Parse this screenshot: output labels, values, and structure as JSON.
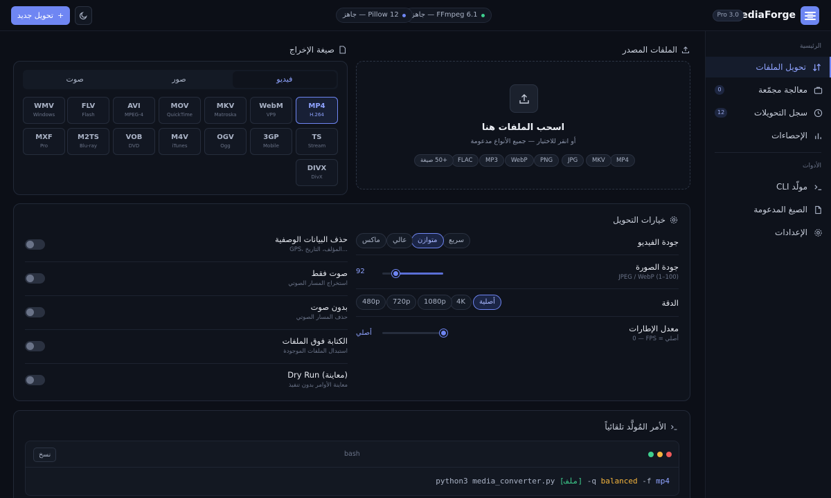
{
  "header": {
    "brand": "MediaForge",
    "badge": "Pro 3.0",
    "status": [
      {
        "label": "FFmpeg 6.1 — جاهز",
        "color": "#3ecf8e"
      },
      {
        "label": "Pillow 12 — جاهز",
        "color": "#6f86f3"
      }
    ],
    "new_button": "تحويل جديد",
    "new_button_icon": "+"
  },
  "sidebar": {
    "main_section": "الرئيسية",
    "tools_section": "الأدوات",
    "items": [
      {
        "label": "تحويل الملفات",
        "icon": "convert-icon",
        "active": true
      },
      {
        "label": "معالجة مجمّعة",
        "icon": "briefcase-icon",
        "count": "0"
      },
      {
        "label": "سجل التحويلات",
        "icon": "clock-icon",
        "count": "12"
      },
      {
        "label": "الإحصاءات",
        "icon": "bar-chart-icon"
      }
    ],
    "tools": [
      {
        "label": "مولّد CLI",
        "icon": "terminal-icon"
      },
      {
        "label": "الصيغ المدعومة",
        "icon": "file-icon"
      },
      {
        "label": "الإعدادات",
        "icon": "gear-icon"
      }
    ]
  },
  "source": {
    "title": "الملفات المصدر",
    "drop_title": "اسحب الملفات هنا",
    "drop_sub": "أو انقر للاختيار — جميع الأنواع مدعومة",
    "chips": [
      "MP4",
      "MKV",
      "JPG",
      "PNG",
      "WebP",
      "MP3",
      "FLAC",
      "+50 صيغة"
    ]
  },
  "output": {
    "title": "صيغة الإخراج",
    "tabs": [
      "فيديو",
      "صور",
      "صوت"
    ],
    "formats": [
      {
        "name": "MP4",
        "sub": "H.264",
        "active": true
      },
      {
        "name": "WebM",
        "sub": "VP9"
      },
      {
        "name": "MKV",
        "sub": "Matroska"
      },
      {
        "name": "MOV",
        "sub": "QuickTime"
      },
      {
        "name": "AVI",
        "sub": "MPEG-4"
      },
      {
        "name": "FLV",
        "sub": "Flash"
      },
      {
        "name": "WMV",
        "sub": "Windows"
      },
      {
        "name": "TS",
        "sub": "Stream"
      },
      {
        "name": "3GP",
        "sub": "Mobile"
      },
      {
        "name": "OGV",
        "sub": "Ogg"
      },
      {
        "name": "M4V",
        "sub": "iTunes"
      },
      {
        "name": "VOB",
        "sub": "DVD"
      },
      {
        "name": "M2TS",
        "sub": "Blu-ray"
      },
      {
        "name": "MXF",
        "sub": "Pro"
      },
      {
        "name": "DIVX",
        "sub": "DivX"
      }
    ]
  },
  "options": {
    "title": "خيارات التحويل",
    "video_quality": {
      "label": "جودة الفيديو",
      "options": [
        "سريع",
        "متوازن",
        "عالي",
        "ماكس"
      ],
      "selected": "متوازن"
    },
    "image_quality": {
      "label": "جودة الصورة",
      "sub": "JPEG / WebP (1–100)",
      "value": "92",
      "fraction": 0.78
    },
    "resolution": {
      "label": "الدقة",
      "options": [
        "أصلية",
        "4K",
        "1080p",
        "720p",
        "480p"
      ],
      "selected": "أصلية"
    },
    "fps": {
      "label": "معدل الإطارات",
      "sub": "0 — FPS = أصلي",
      "value": "أصلي",
      "fraction": 0.0
    },
    "toggles": [
      {
        "label": "حذف البيانات الوصفية",
        "sub": "GPS، المؤلف، التاريخ...",
        "on": false
      },
      {
        "label": "صوت فقط",
        "sub": "استخراج المسار الصوتي",
        "on": false
      },
      {
        "label": "بدون صوت",
        "sub": "حذف المسار الصوتي",
        "on": false
      },
      {
        "label": "الكتابة فوق الملفات",
        "sub": "استبدال الملفات الموجودة",
        "on": false
      },
      {
        "label": "Dry Run (معاينة)",
        "sub": "معاينة الأوامر بدون تنفيذ",
        "on": false
      }
    ]
  },
  "command": {
    "title": "الأمر المُولَّد تلقائياً",
    "copy": "نسخ",
    "lang": "bash",
    "line_prefix": "python3 media_converter.py ",
    "line_arg": "[ملف]",
    "line_flags1": " -q ",
    "line_flag_val": "balanced",
    "line_rest": " -f ",
    "line_fmt": "mp4"
  }
}
